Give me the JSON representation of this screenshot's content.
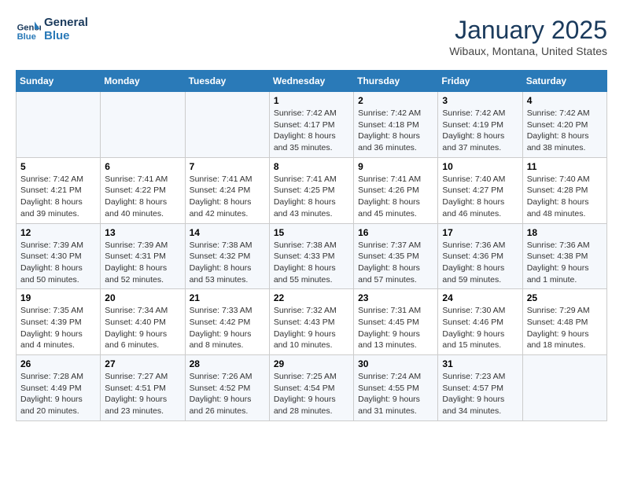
{
  "logo": {
    "line1": "General",
    "line2": "Blue"
  },
  "title": "January 2025",
  "subtitle": "Wibaux, Montana, United States",
  "headers": [
    "Sunday",
    "Monday",
    "Tuesday",
    "Wednesday",
    "Thursday",
    "Friday",
    "Saturday"
  ],
  "weeks": [
    [
      {
        "day": "",
        "info": ""
      },
      {
        "day": "",
        "info": ""
      },
      {
        "day": "",
        "info": ""
      },
      {
        "day": "1",
        "info": "Sunrise: 7:42 AM\nSunset: 4:17 PM\nDaylight: 8 hours and 35 minutes."
      },
      {
        "day": "2",
        "info": "Sunrise: 7:42 AM\nSunset: 4:18 PM\nDaylight: 8 hours and 36 minutes."
      },
      {
        "day": "3",
        "info": "Sunrise: 7:42 AM\nSunset: 4:19 PM\nDaylight: 8 hours and 37 minutes."
      },
      {
        "day": "4",
        "info": "Sunrise: 7:42 AM\nSunset: 4:20 PM\nDaylight: 8 hours and 38 minutes."
      }
    ],
    [
      {
        "day": "5",
        "info": "Sunrise: 7:42 AM\nSunset: 4:21 PM\nDaylight: 8 hours and 39 minutes."
      },
      {
        "day": "6",
        "info": "Sunrise: 7:41 AM\nSunset: 4:22 PM\nDaylight: 8 hours and 40 minutes."
      },
      {
        "day": "7",
        "info": "Sunrise: 7:41 AM\nSunset: 4:24 PM\nDaylight: 8 hours and 42 minutes."
      },
      {
        "day": "8",
        "info": "Sunrise: 7:41 AM\nSunset: 4:25 PM\nDaylight: 8 hours and 43 minutes."
      },
      {
        "day": "9",
        "info": "Sunrise: 7:41 AM\nSunset: 4:26 PM\nDaylight: 8 hours and 45 minutes."
      },
      {
        "day": "10",
        "info": "Sunrise: 7:40 AM\nSunset: 4:27 PM\nDaylight: 8 hours and 46 minutes."
      },
      {
        "day": "11",
        "info": "Sunrise: 7:40 AM\nSunset: 4:28 PM\nDaylight: 8 hours and 48 minutes."
      }
    ],
    [
      {
        "day": "12",
        "info": "Sunrise: 7:39 AM\nSunset: 4:30 PM\nDaylight: 8 hours and 50 minutes."
      },
      {
        "day": "13",
        "info": "Sunrise: 7:39 AM\nSunset: 4:31 PM\nDaylight: 8 hours and 52 minutes."
      },
      {
        "day": "14",
        "info": "Sunrise: 7:38 AM\nSunset: 4:32 PM\nDaylight: 8 hours and 53 minutes."
      },
      {
        "day": "15",
        "info": "Sunrise: 7:38 AM\nSunset: 4:33 PM\nDaylight: 8 hours and 55 minutes."
      },
      {
        "day": "16",
        "info": "Sunrise: 7:37 AM\nSunset: 4:35 PM\nDaylight: 8 hours and 57 minutes."
      },
      {
        "day": "17",
        "info": "Sunrise: 7:36 AM\nSunset: 4:36 PM\nDaylight: 8 hours and 59 minutes."
      },
      {
        "day": "18",
        "info": "Sunrise: 7:36 AM\nSunset: 4:38 PM\nDaylight: 9 hours and 1 minute."
      }
    ],
    [
      {
        "day": "19",
        "info": "Sunrise: 7:35 AM\nSunset: 4:39 PM\nDaylight: 9 hours and 4 minutes."
      },
      {
        "day": "20",
        "info": "Sunrise: 7:34 AM\nSunset: 4:40 PM\nDaylight: 9 hours and 6 minutes."
      },
      {
        "day": "21",
        "info": "Sunrise: 7:33 AM\nSunset: 4:42 PM\nDaylight: 9 hours and 8 minutes."
      },
      {
        "day": "22",
        "info": "Sunrise: 7:32 AM\nSunset: 4:43 PM\nDaylight: 9 hours and 10 minutes."
      },
      {
        "day": "23",
        "info": "Sunrise: 7:31 AM\nSunset: 4:45 PM\nDaylight: 9 hours and 13 minutes."
      },
      {
        "day": "24",
        "info": "Sunrise: 7:30 AM\nSunset: 4:46 PM\nDaylight: 9 hours and 15 minutes."
      },
      {
        "day": "25",
        "info": "Sunrise: 7:29 AM\nSunset: 4:48 PM\nDaylight: 9 hours and 18 minutes."
      }
    ],
    [
      {
        "day": "26",
        "info": "Sunrise: 7:28 AM\nSunset: 4:49 PM\nDaylight: 9 hours and 20 minutes."
      },
      {
        "day": "27",
        "info": "Sunrise: 7:27 AM\nSunset: 4:51 PM\nDaylight: 9 hours and 23 minutes."
      },
      {
        "day": "28",
        "info": "Sunrise: 7:26 AM\nSunset: 4:52 PM\nDaylight: 9 hours and 26 minutes."
      },
      {
        "day": "29",
        "info": "Sunrise: 7:25 AM\nSunset: 4:54 PM\nDaylight: 9 hours and 28 minutes."
      },
      {
        "day": "30",
        "info": "Sunrise: 7:24 AM\nSunset: 4:55 PM\nDaylight: 9 hours and 31 minutes."
      },
      {
        "day": "31",
        "info": "Sunrise: 7:23 AM\nSunset: 4:57 PM\nDaylight: 9 hours and 34 minutes."
      },
      {
        "day": "",
        "info": ""
      }
    ]
  ]
}
